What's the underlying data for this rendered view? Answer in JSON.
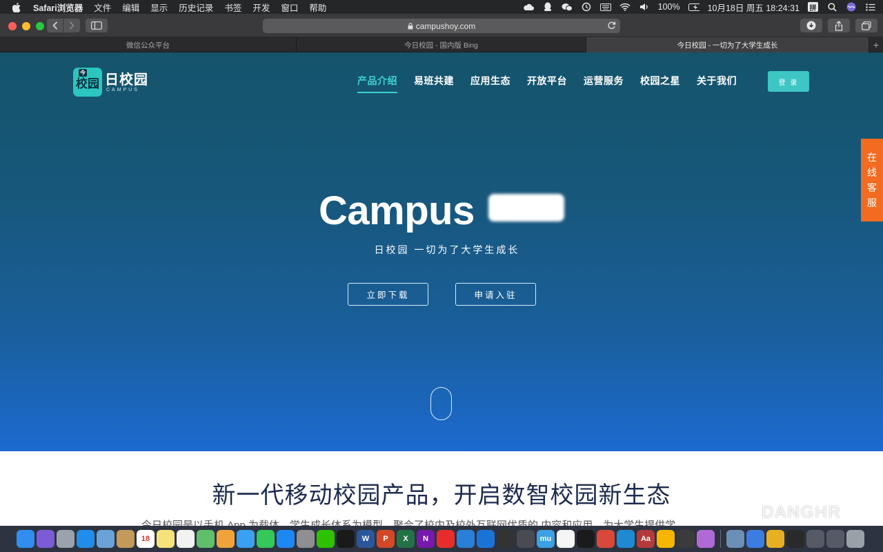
{
  "menubar": {
    "app_name": "Safari浏览器",
    "menus": [
      "文件",
      "编辑",
      "显示",
      "历史记录",
      "书签",
      "开发",
      "窗口",
      "帮助"
    ],
    "battery": "100%",
    "datetime": "10月18日 周五  18:24:31",
    "ime": "拼"
  },
  "browser": {
    "url": "campushoy.com",
    "tabs": [
      {
        "title": "微信公众平台",
        "active": false
      },
      {
        "title": "今日校园 - 国内版 Bing",
        "active": false
      },
      {
        "title": "今日校园 - 一切为了大学生成长",
        "active": true
      }
    ]
  },
  "site": {
    "logo": {
      "badge_text": "校园",
      "badge_small": "今",
      "name": "日校园",
      "subtitle": "CAMPUS"
    },
    "nav": [
      "产品介绍",
      "易班共建",
      "应用生态",
      "开放平台",
      "运营服务",
      "校园之星",
      "关于我们"
    ],
    "active_nav_index": 0,
    "login_label": "登 录",
    "hero": {
      "title": "Campus",
      "subtitle": "日校园 一切为了大学生成长",
      "download_label": "立即下载",
      "apply_label": "申请入驻"
    },
    "side_service": [
      "在",
      "线",
      "客",
      "服"
    ],
    "section": {
      "title": "新一代移动校园产品，开启数智校园新生态",
      "desc": "今日校园是以手机 App 为载体，学生成长体系为模型，聚合了校内及校外互联网优质的 内容和应用，为大学生提供学"
    },
    "watermark": "DANGHR"
  },
  "colors": {
    "accent": "#3dd3cf",
    "login_bg": "#3dc6c4",
    "service_orange": "#f26b21",
    "hero_top": "#15546b",
    "hero_bottom": "#1c6ad0"
  },
  "dock": {
    "apps": [
      {
        "name": "finder-icon",
        "color": "#2f8ef0",
        "label": ""
      },
      {
        "name": "siri-icon",
        "color": "#7b5cd6",
        "label": ""
      },
      {
        "name": "launchpad-icon",
        "color": "#9aa3ad",
        "label": ""
      },
      {
        "name": "safari-icon",
        "color": "#1f8de9",
        "label": ""
      },
      {
        "name": "preview-icon",
        "color": "#6aa3d8",
        "label": ""
      },
      {
        "name": "contacts-icon",
        "color": "#c49a5a",
        "label": ""
      },
      {
        "name": "calendar-icon",
        "color": "#ffffff",
        "label": "18"
      },
      {
        "name": "notes-icon",
        "color": "#f6e27a",
        "label": ""
      },
      {
        "name": "reminders-icon",
        "color": "#f2f2f2",
        "label": ""
      },
      {
        "name": "maps-icon",
        "color": "#5fbf6a",
        "label": ""
      },
      {
        "name": "photos-icon",
        "color": "#f0a33a",
        "label": ""
      },
      {
        "name": "messages-icon",
        "color": "#3aa0f2",
        "label": ""
      },
      {
        "name": "facetime-icon",
        "color": "#34c759",
        "label": ""
      },
      {
        "name": "appstore-icon",
        "color": "#1e88f2",
        "label": ""
      },
      {
        "name": "system-preferences-icon",
        "color": "#8e8e93",
        "label": ""
      },
      {
        "name": "wechat-icon",
        "color": "#2dc100",
        "label": ""
      },
      {
        "name": "qq-icon",
        "color": "#1a1a1a",
        "label": ""
      },
      {
        "name": "word-icon",
        "color": "#2b579a",
        "label": "W"
      },
      {
        "name": "powerpoint-icon",
        "color": "#d24726",
        "label": "P"
      },
      {
        "name": "excel-icon",
        "color": "#217346",
        "label": "X"
      },
      {
        "name": "onenote-icon",
        "color": "#7719aa",
        "label": "N"
      },
      {
        "name": "netease-music-icon",
        "color": "#e72d2c",
        "label": ""
      },
      {
        "name": "edge-icon",
        "color": "#2a7fd6",
        "label": ""
      },
      {
        "name": "quicktime-icon",
        "color": "#1a74d8",
        "label": ""
      },
      {
        "name": "final-cut-icon",
        "color": "#333333",
        "label": ""
      },
      {
        "name": "utility-icon",
        "color": "#4a4a52",
        "label": ""
      },
      {
        "name": "mu-app-icon",
        "color": "#3ba0e6",
        "label": "mu"
      },
      {
        "name": "ticktick-icon",
        "color": "#f5f5f5",
        "label": ""
      },
      {
        "name": "terminal-icon",
        "color": "#1b1b1b",
        "label": ""
      },
      {
        "name": "virtual-machine-icon",
        "color": "#d9483b",
        "label": ""
      },
      {
        "name": "vscode-icon",
        "color": "#1f8ad2",
        "label": ""
      },
      {
        "name": "dictionary-icon",
        "color": "#b33a3a",
        "label": "Aa"
      },
      {
        "name": "sketch-icon",
        "color": "#f7b500",
        "label": ""
      },
      {
        "name": "network-icon",
        "color": "#3b3b3b",
        "label": ""
      },
      {
        "name": "feedback-icon",
        "color": "#b06ad6",
        "label": ""
      }
    ],
    "apps_right": [
      {
        "name": "finder-window-icon",
        "color": "#6c8fb7",
        "label": ""
      },
      {
        "name": "xcode-icon",
        "color": "#3b7de0",
        "label": ""
      },
      {
        "name": "chrome-icon",
        "color": "#e6b022",
        "label": ""
      },
      {
        "name": "iphone-icon",
        "color": "#2a2a2a",
        "label": ""
      },
      {
        "name": "keyboard-icon",
        "color": "#555a66",
        "label": ""
      },
      {
        "name": "keyboard2-icon",
        "color": "#555a66",
        "label": ""
      },
      {
        "name": "trash-icon",
        "color": "#9aa0a8",
        "label": ""
      }
    ]
  }
}
